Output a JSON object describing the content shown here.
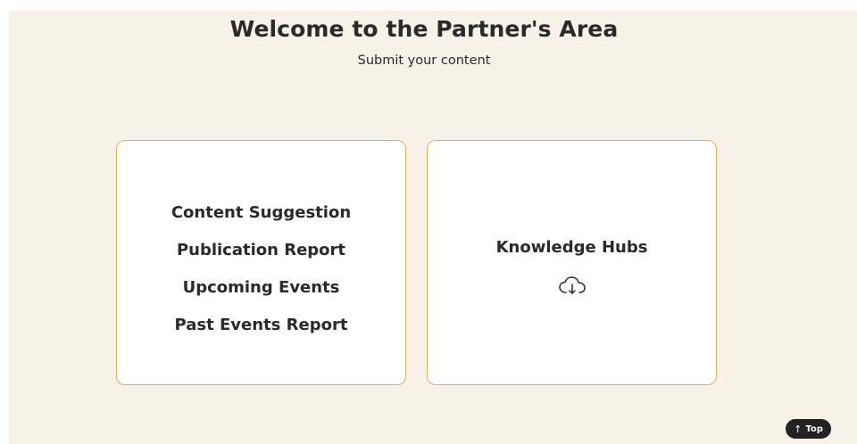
{
  "header": {
    "title": "Welcome to the Partner's Area",
    "subtitle": "Submit your content"
  },
  "submission_card": {
    "links": [
      "Content Suggestion",
      "Publication Report",
      "Upcoming Events",
      "Past Events Report"
    ]
  },
  "hubs_card": {
    "title": "Knowledge Hubs",
    "icon": "cloud-download-icon"
  },
  "scroll_top": {
    "label": "Top",
    "icon": "arrow-up-icon"
  },
  "colors": {
    "page_background": "#f7f2e7",
    "card_border": "#d9b458",
    "text": "#2a2a2a",
    "button_background": "#222222"
  }
}
